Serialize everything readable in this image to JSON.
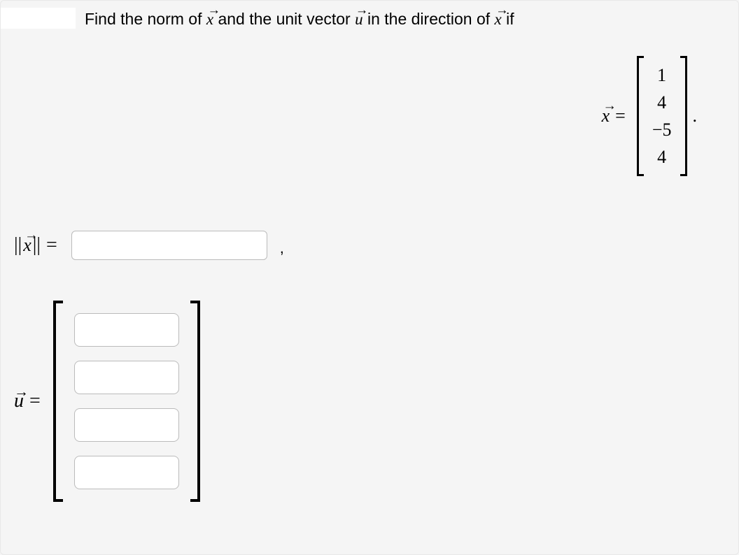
{
  "question": {
    "prompt_part1": "Find the norm of ",
    "prompt_part2": " and the unit vector ",
    "prompt_part3": " in the direction of ",
    "prompt_part4": " if",
    "var_x": "x",
    "var_u": "u"
  },
  "given_vector": {
    "var": "x",
    "values": [
      "1",
      "4",
      "−5",
      "4"
    ]
  },
  "answers": {
    "norm_label_var": "x",
    "norm_value": "",
    "unit_label_var": "u",
    "unit_values": [
      "",
      "",
      "",
      ""
    ]
  },
  "punctuation": {
    "period": ".",
    "comma": ","
  }
}
